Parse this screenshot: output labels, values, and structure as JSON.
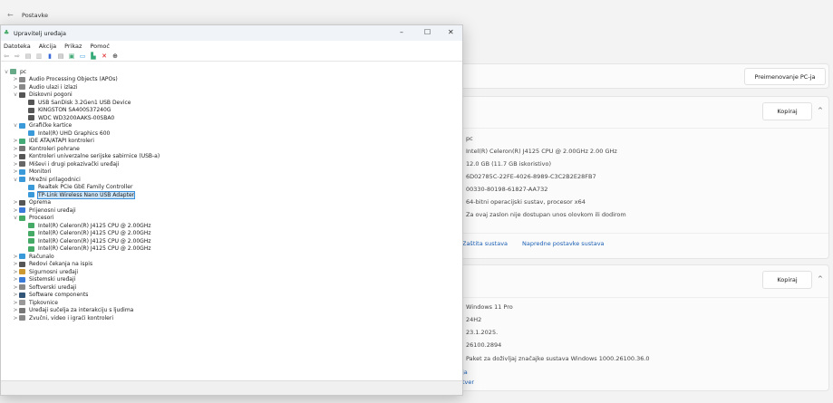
{
  "settings": {
    "back_icon": "arrow-left",
    "title": "Postavke",
    "rename_button": "Preimenovanje PC-ja",
    "device_card": {
      "copy_button": "Kopiraj",
      "values": [
        "pc",
        "Intel(R) Celeron(R) J4125 CPU @ 2.00GHz   2.00 GHz",
        "12.0 GB (11.7 GB iskoristivo)",
        "6D02785C-22FE-4026-8989-C3C2B2E28FB7",
        "00330-80198-61827-AA732",
        "64-bitni operacijski sustav, procesor x64",
        "Za ovaj zaslon nije dostupan unos olovkom ili dodirom"
      ],
      "links": [
        "Zaštita sustava",
        "Napredne postavke sustava"
      ]
    },
    "windows_card": {
      "copy_button": "Kopiraj",
      "values": [
        "Windows 11 Pro",
        "24H2",
        "23.1.2025.",
        "26100.2894",
        "Paket za doživljaj značajke sustava Windows 1000.26100.36.0"
      ],
      "links": [
        "ja",
        "tver"
      ]
    }
  },
  "device_manager": {
    "title": "Upravitelj uređaja",
    "menu": [
      "Datoteka",
      "Akcija",
      "Prikaz",
      "Pomoć"
    ],
    "tree": [
      {
        "label": "pc",
        "level": 0,
        "exp": "v",
        "color": "#6a8"
      },
      {
        "label": "Audio Processing Objects (APOs)",
        "level": 1,
        "exp": ">",
        "color": "#888"
      },
      {
        "label": "Audio ulazi i izlazi",
        "level": 1,
        "exp": ">",
        "color": "#888"
      },
      {
        "label": "Diskovni pogoni",
        "level": 1,
        "exp": "v",
        "color": "#555"
      },
      {
        "label": "USB  SanDisk 3.2Gen1 USB Device",
        "level": 2,
        "exp": "",
        "color": "#555"
      },
      {
        "label": "KINGSTON SA400S37240G",
        "level": 2,
        "exp": "",
        "color": "#555"
      },
      {
        "label": "WDC WD3200AAKS-00SBA0",
        "level": 2,
        "exp": "",
        "color": "#555"
      },
      {
        "label": "Grafičke kartice",
        "level": 1,
        "exp": "v",
        "color": "#3a9ad9"
      },
      {
        "label": "Intel(R) UHD Graphics 600",
        "level": 2,
        "exp": "",
        "color": "#3a9ad9"
      },
      {
        "label": "IDE ATA/ATAPI kontroleri",
        "level": 1,
        "exp": ">",
        "color": "#4a7"
      },
      {
        "label": "Kontroleri pohrane",
        "level": 1,
        "exp": ">",
        "color": "#777"
      },
      {
        "label": "Kontroleri univerzalne serijske sabirnice (USB-a)",
        "level": 1,
        "exp": ">",
        "color": "#555"
      },
      {
        "label": "Miševi i drugi pokazivački uređaji",
        "level": 1,
        "exp": ">",
        "color": "#666"
      },
      {
        "label": "Monitori",
        "level": 1,
        "exp": ">",
        "color": "#3a9ad9"
      },
      {
        "label": "Mrežni prilagodnici",
        "level": 1,
        "exp": "v",
        "color": "#3a9ad9"
      },
      {
        "label": "Realtek PCIe GbE Family Controller",
        "level": 2,
        "exp": "",
        "color": "#3a9ad9"
      },
      {
        "label": "TP-Link Wireless Nano USB Adapter",
        "level": 2,
        "exp": "",
        "color": "#3a9ad9",
        "selected": true
      },
      {
        "label": "Oprema",
        "level": 1,
        "exp": ">",
        "color": "#555"
      },
      {
        "label": "Prijenosni uređaji",
        "level": 1,
        "exp": ">",
        "color": "#3a7ad9"
      },
      {
        "label": "Procesori",
        "level": 1,
        "exp": "v",
        "color": "#4a6"
      },
      {
        "label": "Intel(R) Celeron(R) J4125 CPU @ 2.00GHz",
        "level": 2,
        "exp": "",
        "color": "#4a6"
      },
      {
        "label": "Intel(R) Celeron(R) J4125 CPU @ 2.00GHz",
        "level": 2,
        "exp": "",
        "color": "#4a6"
      },
      {
        "label": "Intel(R) Celeron(R) J4125 CPU @ 2.00GHz",
        "level": 2,
        "exp": "",
        "color": "#4a6"
      },
      {
        "label": "Intel(R) Celeron(R) J4125 CPU @ 2.00GHz",
        "level": 2,
        "exp": "",
        "color": "#4a6"
      },
      {
        "label": "Računalo",
        "level": 1,
        "exp": ">",
        "color": "#3a9ad9"
      },
      {
        "label": "Redovi čekanja na ispis",
        "level": 1,
        "exp": ">",
        "color": "#555"
      },
      {
        "label": "Sigurnosni uređaji",
        "level": 1,
        "exp": ">",
        "color": "#c93"
      },
      {
        "label": "Sistemski uređaji",
        "level": 1,
        "exp": ">",
        "color": "#3a7ad9"
      },
      {
        "label": "Softverski uređaji",
        "level": 1,
        "exp": ">",
        "color": "#888"
      },
      {
        "label": "Software components",
        "level": 1,
        "exp": ">",
        "color": "#357"
      },
      {
        "label": "Tipkovnice",
        "level": 1,
        "exp": ">",
        "color": "#999"
      },
      {
        "label": "Uređaji sučelja za interakciju s ljudima",
        "level": 1,
        "exp": ">",
        "color": "#777"
      },
      {
        "label": "Zvučni, video i igraći kontroleri",
        "level": 1,
        "exp": ">",
        "color": "#888"
      }
    ]
  }
}
